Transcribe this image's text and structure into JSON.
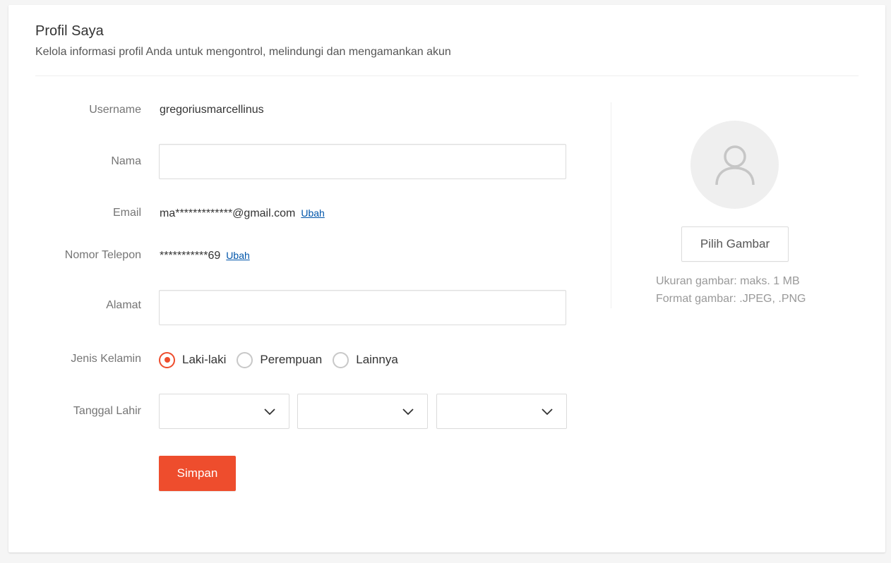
{
  "header": {
    "title": "Profil Saya",
    "subtitle": "Kelola informasi profil Anda untuk mengontrol, melindungi dan mengamankan akun"
  },
  "form": {
    "username_label": "Username",
    "username_value": "gregoriusmarcellinus",
    "name_label": "Nama",
    "name_value": "",
    "email_label": "Email",
    "email_value": "ma*************@gmail.com",
    "email_change": "Ubah",
    "phone_label": "Nomor Telepon",
    "phone_value": "***********69",
    "phone_change": "Ubah",
    "address_label": "Alamat",
    "address_value": "",
    "gender_label": "Jenis Kelamin",
    "gender_options": [
      "Laki-laki",
      "Perempuan",
      "Lainnya"
    ],
    "gender_selected": "Laki-laki",
    "dob_label": "Tanggal Lahir",
    "dob_day": "",
    "dob_month": "",
    "dob_year": "",
    "save_label": "Simpan"
  },
  "avatar_panel": {
    "avatar_icon": "user-icon",
    "pick_label": "Pilih Gambar",
    "size_hint": "Ukuran gambar: maks. 1 MB",
    "format_hint": "Format gambar: .JPEG, .PNG"
  },
  "colors": {
    "accent": "#ee4d2d",
    "link": "#0055aa"
  }
}
